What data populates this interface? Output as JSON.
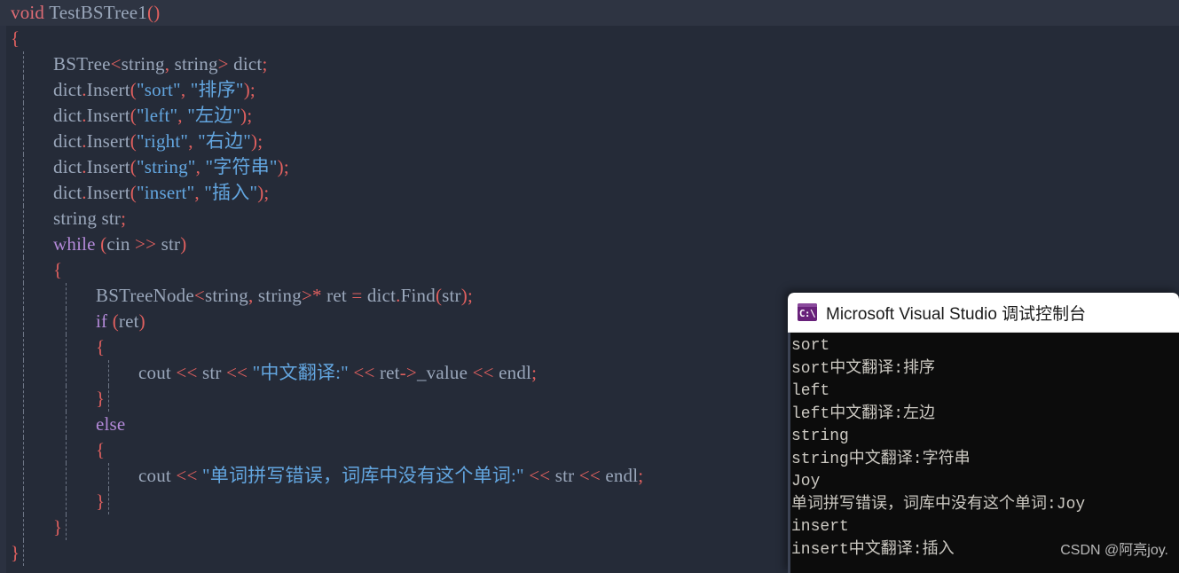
{
  "editor": {
    "language": "cpp",
    "theme": "dark",
    "background_color": "#252b38",
    "current_line_color": "#2e3442",
    "lines": [
      {
        "indent": 0,
        "guides": 0,
        "current": true,
        "tokens": [
          {
            "t": "void",
            "c": "kw"
          },
          {
            "t": " ",
            "c": "id"
          },
          {
            "t": "TestBSTree1",
            "c": "id"
          },
          {
            "t": "()",
            "c": "pun"
          }
        ]
      },
      {
        "indent": 0,
        "guides": 0,
        "current": false,
        "tokens": [
          {
            "t": "{",
            "c": "brc"
          }
        ]
      },
      {
        "indent": 1,
        "guides": 1,
        "current": false,
        "tokens": [
          {
            "t": "BSTree",
            "c": "typ"
          },
          {
            "t": "<",
            "c": "pun"
          },
          {
            "t": "string",
            "c": "typ"
          },
          {
            "t": ", ",
            "c": "pun"
          },
          {
            "t": "string",
            "c": "typ"
          },
          {
            "t": ">",
            "c": "pun"
          },
          {
            "t": " dict",
            "c": "id"
          },
          {
            "t": ";",
            "c": "pun"
          }
        ]
      },
      {
        "indent": 1,
        "guides": 1,
        "current": false,
        "tokens": [
          {
            "t": "dict",
            "c": "id"
          },
          {
            "t": ".",
            "c": "pun"
          },
          {
            "t": "Insert",
            "c": "mem"
          },
          {
            "t": "(",
            "c": "pun"
          },
          {
            "t": "\"sort\"",
            "c": "str"
          },
          {
            "t": ", ",
            "c": "pun"
          },
          {
            "t": "\"排序\"",
            "c": "str"
          },
          {
            "t": ");",
            "c": "pun"
          }
        ]
      },
      {
        "indent": 1,
        "guides": 1,
        "current": false,
        "tokens": [
          {
            "t": "dict",
            "c": "id"
          },
          {
            "t": ".",
            "c": "pun"
          },
          {
            "t": "Insert",
            "c": "mem"
          },
          {
            "t": "(",
            "c": "pun"
          },
          {
            "t": "\"left\"",
            "c": "str"
          },
          {
            "t": ", ",
            "c": "pun"
          },
          {
            "t": "\"左边\"",
            "c": "str"
          },
          {
            "t": ");",
            "c": "pun"
          }
        ]
      },
      {
        "indent": 1,
        "guides": 1,
        "current": false,
        "tokens": [
          {
            "t": "dict",
            "c": "id"
          },
          {
            "t": ".",
            "c": "pun"
          },
          {
            "t": "Insert",
            "c": "mem"
          },
          {
            "t": "(",
            "c": "pun"
          },
          {
            "t": "\"right\"",
            "c": "str"
          },
          {
            "t": ", ",
            "c": "pun"
          },
          {
            "t": "\"右边\"",
            "c": "str"
          },
          {
            "t": ");",
            "c": "pun"
          }
        ]
      },
      {
        "indent": 1,
        "guides": 1,
        "current": false,
        "tokens": [
          {
            "t": "dict",
            "c": "id"
          },
          {
            "t": ".",
            "c": "pun"
          },
          {
            "t": "Insert",
            "c": "mem"
          },
          {
            "t": "(",
            "c": "pun"
          },
          {
            "t": "\"string\"",
            "c": "str"
          },
          {
            "t": ", ",
            "c": "pun"
          },
          {
            "t": "\"字符串\"",
            "c": "str"
          },
          {
            "t": ");",
            "c": "pun"
          }
        ]
      },
      {
        "indent": 1,
        "guides": 1,
        "current": false,
        "tokens": [
          {
            "t": "dict",
            "c": "id"
          },
          {
            "t": ".",
            "c": "pun"
          },
          {
            "t": "Insert",
            "c": "mem"
          },
          {
            "t": "(",
            "c": "pun"
          },
          {
            "t": "\"insert\"",
            "c": "str"
          },
          {
            "t": ", ",
            "c": "pun"
          },
          {
            "t": "\"插入\"",
            "c": "str"
          },
          {
            "t": ");",
            "c": "pun"
          }
        ]
      },
      {
        "indent": 1,
        "guides": 1,
        "current": false,
        "tokens": [
          {
            "t": "string",
            "c": "typ"
          },
          {
            "t": " str",
            "c": "id"
          },
          {
            "t": ";",
            "c": "pun"
          }
        ]
      },
      {
        "indent": 1,
        "guides": 1,
        "current": false,
        "tokens": [
          {
            "t": "while",
            "c": "kw2"
          },
          {
            "t": " ",
            "c": "id"
          },
          {
            "t": "(",
            "c": "pun"
          },
          {
            "t": "cin",
            "c": "id"
          },
          {
            "t": " ",
            "c": "id"
          },
          {
            "t": ">>",
            "c": "op"
          },
          {
            "t": " str",
            "c": "id"
          },
          {
            "t": ")",
            "c": "pun"
          }
        ]
      },
      {
        "indent": 1,
        "guides": 1,
        "current": false,
        "tokens": [
          {
            "t": "{",
            "c": "brc"
          }
        ]
      },
      {
        "indent": 2,
        "guides": 2,
        "current": false,
        "tokens": [
          {
            "t": "BSTreeNode",
            "c": "typ"
          },
          {
            "t": "<",
            "c": "pun"
          },
          {
            "t": "string",
            "c": "typ"
          },
          {
            "t": ", ",
            "c": "pun"
          },
          {
            "t": "string",
            "c": "typ"
          },
          {
            "t": ">",
            "c": "pun"
          },
          {
            "t": "*",
            "c": "op"
          },
          {
            "t": " ret ",
            "c": "id"
          },
          {
            "t": "=",
            "c": "op"
          },
          {
            "t": " dict",
            "c": "id"
          },
          {
            "t": ".",
            "c": "pun"
          },
          {
            "t": "Find",
            "c": "mem"
          },
          {
            "t": "(",
            "c": "pun"
          },
          {
            "t": "str",
            "c": "id"
          },
          {
            "t": ");",
            "c": "pun"
          }
        ]
      },
      {
        "indent": 2,
        "guides": 2,
        "current": false,
        "tokens": [
          {
            "t": "if",
            "c": "kw2"
          },
          {
            "t": " ",
            "c": "id"
          },
          {
            "t": "(",
            "c": "pun"
          },
          {
            "t": "ret",
            "c": "id"
          },
          {
            "t": ")",
            "c": "pun"
          }
        ]
      },
      {
        "indent": 2,
        "guides": 2,
        "current": false,
        "tokens": [
          {
            "t": "{",
            "c": "brc"
          }
        ]
      },
      {
        "indent": 3,
        "guides": 3,
        "current": false,
        "tokens": [
          {
            "t": "cout",
            "c": "id"
          },
          {
            "t": " ",
            "c": "id"
          },
          {
            "t": "<<",
            "c": "op"
          },
          {
            "t": " str ",
            "c": "id"
          },
          {
            "t": "<<",
            "c": "op"
          },
          {
            "t": " ",
            "c": "id"
          },
          {
            "t": "\"中文翻译:\"",
            "c": "str"
          },
          {
            "t": " ",
            "c": "id"
          },
          {
            "t": "<<",
            "c": "op"
          },
          {
            "t": " ret",
            "c": "id"
          },
          {
            "t": "->",
            "c": "op"
          },
          {
            "t": "_value",
            "c": "id"
          },
          {
            "t": " ",
            "c": "id"
          },
          {
            "t": "<<",
            "c": "op"
          },
          {
            "t": " endl",
            "c": "id"
          },
          {
            "t": ";",
            "c": "pun"
          }
        ]
      },
      {
        "indent": 2,
        "guides": 3,
        "current": false,
        "tokens": [
          {
            "t": "}",
            "c": "brc"
          }
        ]
      },
      {
        "indent": 2,
        "guides": 2,
        "current": false,
        "tokens": [
          {
            "t": "else",
            "c": "kw2"
          }
        ]
      },
      {
        "indent": 2,
        "guides": 2,
        "current": false,
        "tokens": [
          {
            "t": "{",
            "c": "brc"
          }
        ]
      },
      {
        "indent": 3,
        "guides": 3,
        "current": false,
        "tokens": [
          {
            "t": "cout",
            "c": "id"
          },
          {
            "t": " ",
            "c": "id"
          },
          {
            "t": "<<",
            "c": "op"
          },
          {
            "t": " ",
            "c": "id"
          },
          {
            "t": "\"单词拼写错误，词库中没有这个单词:\"",
            "c": "str"
          },
          {
            "t": " ",
            "c": "id"
          },
          {
            "t": "<<",
            "c": "op"
          },
          {
            "t": " str ",
            "c": "id"
          },
          {
            "t": "<<",
            "c": "op"
          },
          {
            "t": " endl",
            "c": "id"
          },
          {
            "t": ";",
            "c": "pun"
          }
        ]
      },
      {
        "indent": 2,
        "guides": 3,
        "current": false,
        "tokens": [
          {
            "t": "}",
            "c": "brc"
          }
        ]
      },
      {
        "indent": 1,
        "guides": 2,
        "current": false,
        "tokens": [
          {
            "t": "}",
            "c": "brc"
          }
        ]
      },
      {
        "indent": 0,
        "guides": 1,
        "current": false,
        "tokens": [
          {
            "t": "}",
            "c": "brc"
          }
        ]
      }
    ]
  },
  "console": {
    "title": "Microsoft Visual Studio 调试控制台",
    "icon": "console-cmd-icon",
    "icon_glyph": "C:\\",
    "icon_color": "#68217a",
    "titlebar_color": "#ffffff",
    "background_color": "#0c0c0c",
    "text_color": "#ccc9c2",
    "output_lines": [
      "sort",
      "sort中文翻译:排序",
      "left",
      "left中文翻译:左边",
      "string",
      "string中文翻译:字符串",
      "Joy",
      "单词拼写错误，词库中没有这个单词:Joy",
      "insert",
      "insert中文翻译:插入"
    ]
  },
  "watermark": {
    "text": "CSDN @阿亮joy."
  }
}
